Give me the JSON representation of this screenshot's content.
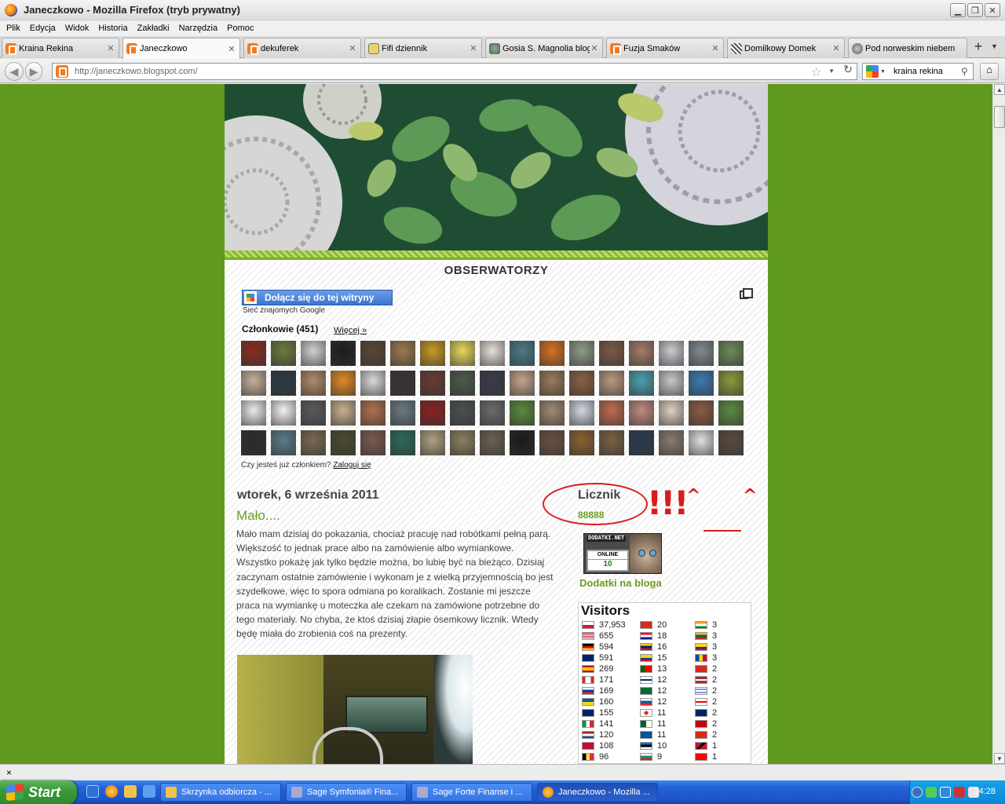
{
  "window": {
    "title": "Janeczkowo - Mozilla Firefox (tryb prywatny)"
  },
  "menu": [
    "Plik",
    "Edycja",
    "Widok",
    "Historia",
    "Zakładki",
    "Narzędzia",
    "Pomoc"
  ],
  "tabs": [
    {
      "label": "Kraina Rekina",
      "icon": "blogger-icon"
    },
    {
      "label": "Janeczkowo",
      "icon": "blogger-icon",
      "active": true
    },
    {
      "label": "dekuferek",
      "icon": "blogger-icon"
    },
    {
      "label": "Fifi dziennik",
      "icon": "gift-icon"
    },
    {
      "label": "Gosia S. Magnolia blog",
      "icon": "gear-icon"
    },
    {
      "label": "Fuzja Smaków",
      "icon": "blogger-icon"
    },
    {
      "label": "Domilkowy Domek",
      "icon": "pattern-icon"
    },
    {
      "label": "Pod norweskim niebem",
      "icon": "globe-icon"
    }
  ],
  "nav": {
    "url": "http://janeczkowo.blogspot.com/",
    "search": "kraina rekina"
  },
  "blog": {
    "followers_title": "OBSERWATORZY",
    "join_label": "Dołącz się do tej witryny",
    "google_network": "Sieć znajomych Google",
    "members_label": "Członkowie (451)",
    "more_label": "Więcej »",
    "already_member": "Czy jesteś już członkiem?",
    "login_link": "Zaloguj się",
    "avatar_count": 68
  },
  "post": {
    "date": "wtorek, 6 września 2011",
    "title": "Mało....",
    "body": "Mało mam dzisiaj do pokazania, chociaż pracuję nad robótkami pełną parą. Większość to jednak prace albo na zamówienie albo wymiankowe. Wszystko pokażę jak tylko będzie można, bo lubię być na bieżąco. Dzisiaj zaczynam ostatnie zamówienie i wykonam je z wielką przyjemnością bo jest szydełkowe, więc to spora odmiana po koralikach. Zostanie mi jeszcze praca na wymiankę u moteczka ale czekam na zamówione potrzebne do tego materiały. No chyba, że ktoś dzisiaj złapie ósemkowy licznik. Wtedy będę miała do zrobienia coś na prezenty."
  },
  "sidebar": {
    "counter_title": "Licznik",
    "counter_value": "88888",
    "annotation_marks": "!!!",
    "dodatki_badge": "DODATKI.NET",
    "dodatki_online": "ONLINE",
    "dodatki_count": "10",
    "dodatki_link": "Dodatki na bloga",
    "visitors_title": "Visitors",
    "visitors": [
      [
        {
          "flag": "pl",
          "count": "37,953"
        },
        {
          "flag": "us",
          "count": "655"
        },
        {
          "flag": "de",
          "count": "594"
        },
        {
          "flag": "gb",
          "count": "591"
        },
        {
          "flag": "es",
          "count": "269"
        },
        {
          "flag": "ca",
          "count": "171"
        },
        {
          "flag": "ru",
          "count": "169"
        },
        {
          "flag": "ua",
          "count": "160"
        },
        {
          "flag": "au",
          "count": "155"
        },
        {
          "flag": "it",
          "count": "141"
        },
        {
          "flag": "nl",
          "count": "120"
        },
        {
          "flag": "dk",
          "count": "108"
        },
        {
          "flag": "be",
          "count": "96"
        }
      ],
      [
        {
          "flag": "ch",
          "count": "20"
        },
        {
          "flag": "hr",
          "count": "18"
        },
        {
          "flag": "ve",
          "count": "16"
        },
        {
          "flag": "co",
          "count": "15"
        },
        {
          "flag": "pt",
          "count": "13"
        },
        {
          "flag": "fi",
          "count": "12"
        },
        {
          "flag": "sa",
          "count": "12"
        },
        {
          "flag": "si",
          "count": "12"
        },
        {
          "flag": "kr",
          "count": "11"
        },
        {
          "flag": "dz",
          "count": "11"
        },
        {
          "flag": "is",
          "count": "11"
        },
        {
          "flag": "ee",
          "count": "10"
        },
        {
          "flag": "bg",
          "count": "9"
        }
      ],
      [
        {
          "flag": "in",
          "count": "3"
        },
        {
          "flag": "lt",
          "count": "3"
        },
        {
          "flag": "co",
          "count": "3"
        },
        {
          "flag": "md",
          "count": "3"
        },
        {
          "flag": "vn",
          "count": "2"
        },
        {
          "flag": "lv",
          "count": "2"
        },
        {
          "flag": "il",
          "count": "2"
        },
        {
          "flag": "ge",
          "count": "2"
        },
        {
          "flag": "gb",
          "count": "2"
        },
        {
          "flag": "me",
          "count": "2"
        },
        {
          "flag": "hk",
          "count": "2"
        },
        {
          "flag": "tt",
          "count": "1"
        },
        {
          "flag": "tw",
          "count": "1"
        }
      ]
    ]
  },
  "status": {
    "text": "×"
  },
  "taskbar": {
    "start": "Start",
    "buttons": [
      {
        "label": "Skrzynka odbiorcza - ...",
        "icon": "clock-icon"
      },
      {
        "label": "Sage Symfonia® Fina...",
        "icon": "app-icon"
      },
      {
        "label": "Sage Forte Finanse i ...",
        "icon": "app-icon"
      },
      {
        "label": "Janeczkowo - Mozilla ...",
        "icon": "firefox-icon",
        "active": true
      }
    ],
    "clock": "14:28"
  },
  "colors": {
    "page_bg": "#5f9a1f",
    "accent_green": "#6a9e1f",
    "annotation_red": "#d91c1c"
  }
}
